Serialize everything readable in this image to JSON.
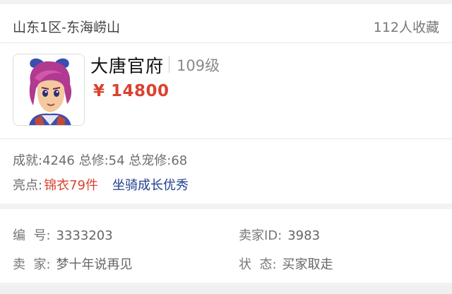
{
  "listing": {
    "server": "山东1区-东海崂山",
    "favorites": "112人收藏",
    "school": "大唐官府",
    "level": "109级",
    "price": "¥ 14800",
    "stats": "成就:4246 总修:54 总宠修:68",
    "highlight_label": "亮点:",
    "highlight_red": "锦衣79件",
    "highlight_blue": "坐骑成长优秀"
  },
  "details": {
    "id_label": "编  号:",
    "id_value": "3333203",
    "seller_id_label": "卖家ID:",
    "seller_id_value": "3983",
    "seller_label": "卖  家:",
    "seller_value": "梦十年说再见",
    "status_label": "状  态:",
    "status_value": "买家取走"
  },
  "colors": {
    "price": "#d9432f",
    "highlight_red": "#d9432f",
    "highlight_blue": "#1f3f8f"
  },
  "icons": {
    "avatar": "character-portrait-icon"
  }
}
